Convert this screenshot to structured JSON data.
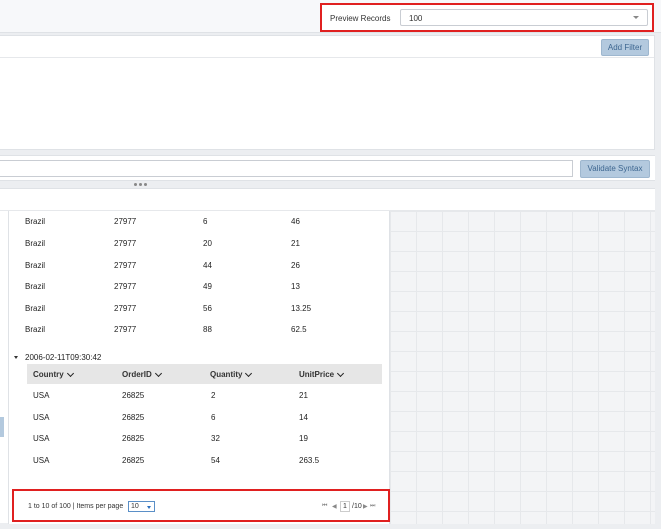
{
  "preview": {
    "label": "Preview Records",
    "value": "100"
  },
  "filter": {
    "add_filter_label": "Add Filter"
  },
  "syntax": {
    "validate_label": "Validate Syntax"
  },
  "group1": {
    "rows": [
      [
        "Brazil",
        "27977",
        "6",
        "46"
      ],
      [
        "Brazil",
        "27977",
        "20",
        "21"
      ],
      [
        "Brazil",
        "27977",
        "44",
        "26"
      ],
      [
        "Brazil",
        "27977",
        "49",
        "13"
      ],
      [
        "Brazil",
        "27977",
        "56",
        "13.25"
      ],
      [
        "Brazil",
        "27977",
        "88",
        "62.5"
      ]
    ]
  },
  "group2": {
    "label": "2006-02-11T09:30:42",
    "columns": [
      "Country",
      "OrderID",
      "Quantity",
      "UnitPrice"
    ],
    "rows": [
      [
        "USA",
        "26825",
        "2",
        "21"
      ],
      [
        "USA",
        "26825",
        "6",
        "14"
      ],
      [
        "USA",
        "26825",
        "32",
        "19"
      ],
      [
        "USA",
        "26825",
        "54",
        "263.5"
      ]
    ]
  },
  "pager": {
    "summary": "1 to 10 of 100 | Items per page",
    "per_page": "10",
    "current_page": "1",
    "total_pages": "/10"
  },
  "icons": {
    "first": "first-page-icon",
    "prev": "prev-page-icon",
    "next": "next-page-icon",
    "last": "last-page-icon"
  },
  "colors": {
    "highlight": "#e02020",
    "button_bg": "#b3c9de",
    "button_text": "#3d6690"
  }
}
